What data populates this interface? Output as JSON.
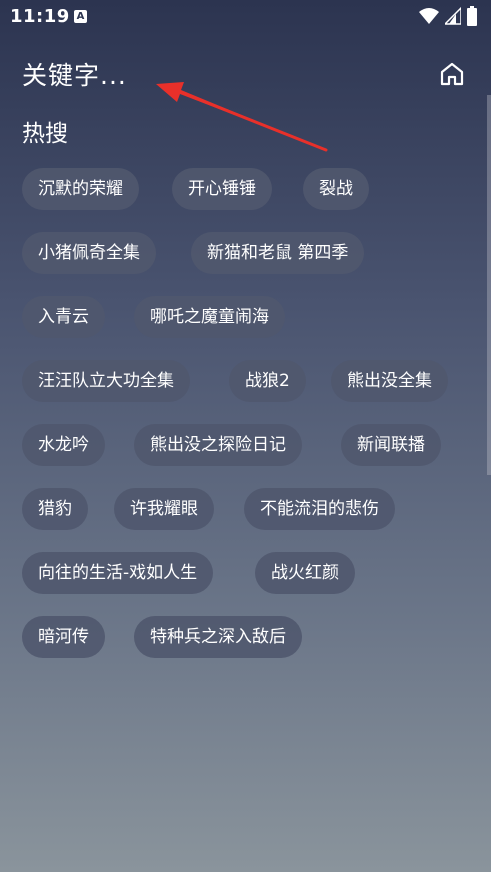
{
  "status_bar": {
    "time": "11:19",
    "notification_icon": "A"
  },
  "header": {
    "title": "关键字...",
    "home_icon": "home-icon"
  },
  "hot_search": {
    "title": "热搜",
    "tags": [
      "沉默的荣耀",
      "开心锤锤",
      "裂战",
      "小猪佩奇全集",
      "新猫和老鼠 第四季",
      "入青云",
      "哪吒之魔童闹海",
      "汪汪队立大功全集",
      "战狼2",
      "熊出没全集",
      "水龙吟",
      "熊出没之探险日记",
      "新闻联播",
      "猎豹",
      "许我耀眼",
      "不能流泪的悲伤",
      "向往的生活-戏如人生",
      "战火红颜",
      "暗河传",
      "特种兵之深入敌后"
    ]
  },
  "colors": {
    "background_top": "#2c3450",
    "background_bottom": "#8a949c",
    "tag_background": "#50586e",
    "annotation_arrow": "#e8302a"
  }
}
